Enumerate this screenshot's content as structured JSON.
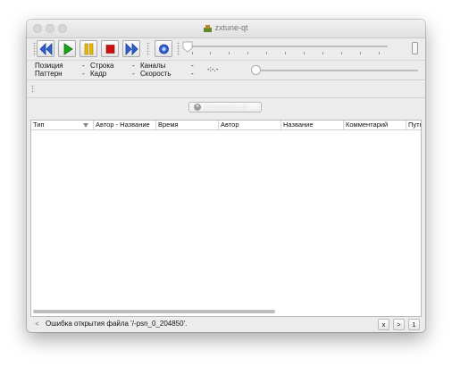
{
  "window": {
    "title": "zxtune-qt"
  },
  "info": {
    "position_label": "Позиция",
    "position_value": "-",
    "pattern_label": "Паттерн",
    "pattern_value": "-",
    "line_label": "Строка",
    "line_value": "-",
    "frame_label": "Кадр",
    "frame_value": "-",
    "channels_label": "Каналы",
    "channels_value": "-",
    "speed_label": "Скорость",
    "speed_value": "-",
    "time": "-:-.-"
  },
  "playlist": {
    "filter_label": "Безымянный",
    "columns": [
      "Тип",
      "Автор - Название",
      "Время",
      "Автор",
      "Название",
      "Комментарий",
      "Путь"
    ]
  },
  "status": {
    "prev_label": "<",
    "message": "Ошибка открытия файла '/-psn_0_204850'.",
    "close_label": "x",
    "next_label": ">",
    "count_label": "1"
  },
  "colors": {
    "accent_blue": "#2f5fd0",
    "play_green": "#17a317",
    "pause_yellow": "#e8b400",
    "stop_red": "#cc1010"
  }
}
